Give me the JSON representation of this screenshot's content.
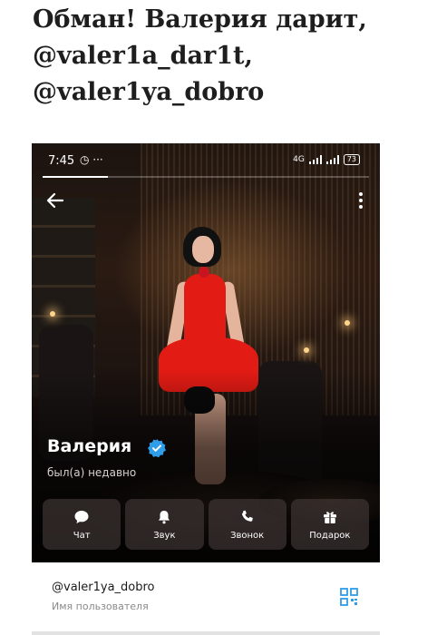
{
  "article": {
    "title": "Обман! Валерия дарит, @valer1a_dar1t, @valer1ya_dobro"
  },
  "screenshot": {
    "status_bar": {
      "time": "7:45",
      "extra": "◷ ···",
      "network": "4G",
      "battery": "73"
    },
    "story_progress_fraction": 0.2,
    "profile": {
      "name": "Валерия",
      "last_seen": "был(а) недавно",
      "verified": true
    },
    "actions": [
      {
        "label": "Чат",
        "icon": "chat-icon"
      },
      {
        "label": "Звук",
        "icon": "bell-icon"
      },
      {
        "label": "Звонок",
        "icon": "phone-icon"
      },
      {
        "label": "Подарок",
        "icon": "gift-icon"
      }
    ],
    "info": {
      "username": "@valer1ya_dobro",
      "username_caption": "Имя пользователя"
    },
    "colors": {
      "accent": "#2f9de8",
      "dress": "#e21b14"
    }
  }
}
